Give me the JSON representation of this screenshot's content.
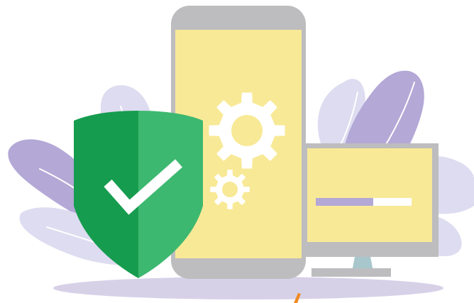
{
  "illustration": {
    "colors": {
      "background": "#ffffff",
      "leaf_dark": "#b3a8d6",
      "leaf_light": "#dddcf0",
      "leaf_vein": "#ffffff",
      "ground_shadow": "#d7d1e8",
      "device_frame": "#bdbdbf",
      "screen": "#f8e996",
      "gear": "#ffffff",
      "progress_track": "#ffffff",
      "progress_fill": "#b3a8d6",
      "monitor_neck": "#a7c7cc",
      "shield_dark": "#169c4f",
      "shield_light": "#3db870",
      "checkmark": "#ffffff",
      "accent_orange": "#f08a24"
    },
    "progress_bar": {
      "value_percent": 60
    },
    "icons": [
      "shield-check-icon",
      "gear-icon",
      "checkmark-icon"
    ]
  }
}
